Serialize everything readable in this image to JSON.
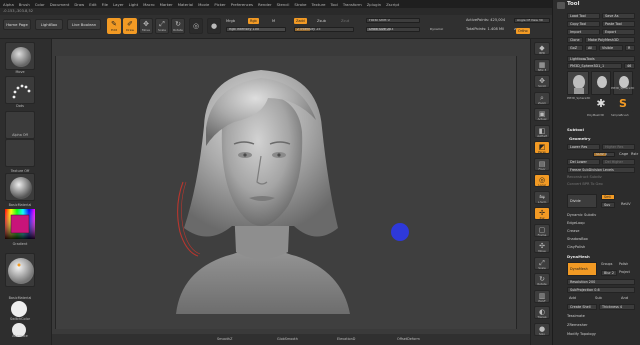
{
  "menubar": [
    "Alpha",
    "Brush",
    "Color",
    "Document",
    "Draw",
    "Edit",
    "File",
    "Layer",
    "Light",
    "Macro",
    "Marker",
    "Material",
    "Movie",
    "Picker",
    "Preferences",
    "Render",
    "Stencil",
    "Stroke",
    "Texture",
    "Tool",
    "Transform",
    "Zplugin",
    "Zscript"
  ],
  "coords": "-0.153,-303.8,52",
  "toolbar": {
    "home_page": "Home Page",
    "lightbox": "LightBox",
    "live_boolean": "Live Boolean",
    "edit": "Edit",
    "draw": "Draw",
    "move": "Move",
    "scale": "Scale",
    "rotate": "Rotate",
    "mrgb": "Mrgb",
    "rgb": "Rgb",
    "m": "M",
    "zadd": "Zadd",
    "zsub": "Zsub",
    "zcut": "Zcut",
    "rgb_intensity": "Rgb Intensity 100",
    "z_intensity": "Z Intensity 25",
    "focal_shift": "Focal Shift 0",
    "draw_size": "Draw Size 283",
    "dynamic": "Dynamic",
    "active_points": "ActivePoints: 425,004",
    "total_points": "TotalPoints: 1.408 Mil",
    "angle_of_view": "Angle Of View 30",
    "zoom": "Zoom",
    "ortho_label": "Ortho"
  },
  "left_shelf": {
    "brush_label": "Move",
    "stroke_label": "Dots",
    "alpha_label": "Alpha Off",
    "texture_label": "Texture Off",
    "material_label": "BasicMaterial",
    "gradient_label": "Gradient",
    "switch_color": "SwitchColor",
    "alternate": "Alternate"
  },
  "bottom_bar": [
    "SmoothZ",
    "GlobSmooth",
    "ElevationD",
    "OffsetDeform"
  ],
  "right_shelf": {
    "buttons": [
      {
        "label": "BPR",
        "icon": "render-icon",
        "glyph": "◆",
        "orange": false
      },
      {
        "label": "SPix 3",
        "icon": "spix-icon",
        "glyph": "▦",
        "orange": false
      },
      {
        "label": "Scroll",
        "icon": "scroll-icon",
        "glyph": "✥",
        "orange": false
      },
      {
        "label": "Zoom",
        "icon": "zoom-icon",
        "glyph": "⌕",
        "orange": false
      },
      {
        "label": "Actual",
        "icon": "actual-icon",
        "glyph": "▣",
        "orange": false
      },
      {
        "label": "AAHalf",
        "icon": "aahalf-icon",
        "glyph": "◧",
        "orange": false
      },
      {
        "label": "Persp",
        "icon": "persp-icon",
        "glyph": "◩",
        "orange": true
      },
      {
        "label": "Floor",
        "icon": "floor-icon",
        "glyph": "▤",
        "orange": false
      },
      {
        "label": "Local",
        "icon": "local-icon",
        "glyph": "◎",
        "orange": true
      },
      {
        "label": "L.Sym",
        "icon": "lsym-icon",
        "glyph": "⇋",
        "orange": false
      },
      {
        "label": "Xyz",
        "icon": "xyz-icon",
        "glyph": "✢",
        "orange": true
      },
      {
        "label": "Frame",
        "icon": "frame-icon",
        "glyph": "▢",
        "orange": false
      },
      {
        "label": "Move",
        "icon": "move-icon",
        "glyph": "✣",
        "orange": false
      },
      {
        "label": "Scale",
        "icon": "scale-icon",
        "glyph": "⤢",
        "orange": false
      },
      {
        "label": "Rotate",
        "icon": "rotate-icon",
        "glyph": "↻",
        "orange": false
      },
      {
        "label": "PolyF",
        "icon": "polyframe-icon",
        "glyph": "▥",
        "orange": false
      },
      {
        "label": "Transp",
        "icon": "transp-icon",
        "glyph": "◐",
        "orange": false
      },
      {
        "label": "Solo",
        "icon": "solo-icon",
        "glyph": "●",
        "orange": false
      }
    ]
  },
  "tool_panel": {
    "title": "Tool",
    "load_tool": "Load Tool",
    "save_as": "Save As",
    "copy_tool": "Copy Tool",
    "paste_tool": "Paste Tool",
    "import": "Import",
    "export": "Export",
    "clone": "Clone",
    "make_polymesh": "Make PolyMesh3D",
    "goz": "GoZ",
    "all": "All",
    "visible": "Visible",
    "r": "R",
    "lightbox_tools": "Lightbox▸Tools",
    "current_tool": "PM3D_Sphere3D1_1",
    "current_tool_count": "46",
    "thumbs": [
      "PM3D_Sphere3D",
      "PM3D_Sphere3D",
      "PolyMesh3D",
      "SimpleBrush"
    ],
    "subtool": "Subtool",
    "geometry": "Geometry",
    "lower_res": "Lower Res",
    "higher_res": "Higher Res",
    "sdiv": "SDiv 3",
    "cage": "Cage",
    "rstr": "Rstr",
    "del_lower": "Del Lower",
    "del_higher": "Del Higher",
    "freeze_subdiv": "Freeze SubDivision Levels",
    "reconstruct_subdiv": "Reconstruct Subdiv",
    "convert_bpr": "Convert BPR To Geo",
    "divide": "Divide",
    "smt": "Smt",
    "suv": "Suv",
    "reuv": "ReUV",
    "dynamic_subdiv": "Dynamic Subdiv",
    "edgeloop": "EdgeLoop",
    "crease": "Crease",
    "shadowbox": "ShadowBox",
    "claypolish": "ClayPolish",
    "dynamesh_section": "DynaMesh",
    "dynamesh_btn": "DynaMesh",
    "groups": "Groups",
    "polish": "Polish",
    "blur": "Blur 2",
    "project": "Project",
    "resolution": "Resolution 200",
    "subprojection": "SubProjection 0.6",
    "add": "Add",
    "sub": "Sub",
    "and": "And",
    "create_shell": "Create Shell",
    "thickness": "Thickness 4",
    "zremesher": "ZRemesher",
    "tessimate": "Tessimate",
    "modify_topology": "Modify Topology"
  },
  "colors": {
    "accent": "#f29a24",
    "gizmo": "#2e39d9",
    "panel": "#2c2c2c"
  }
}
